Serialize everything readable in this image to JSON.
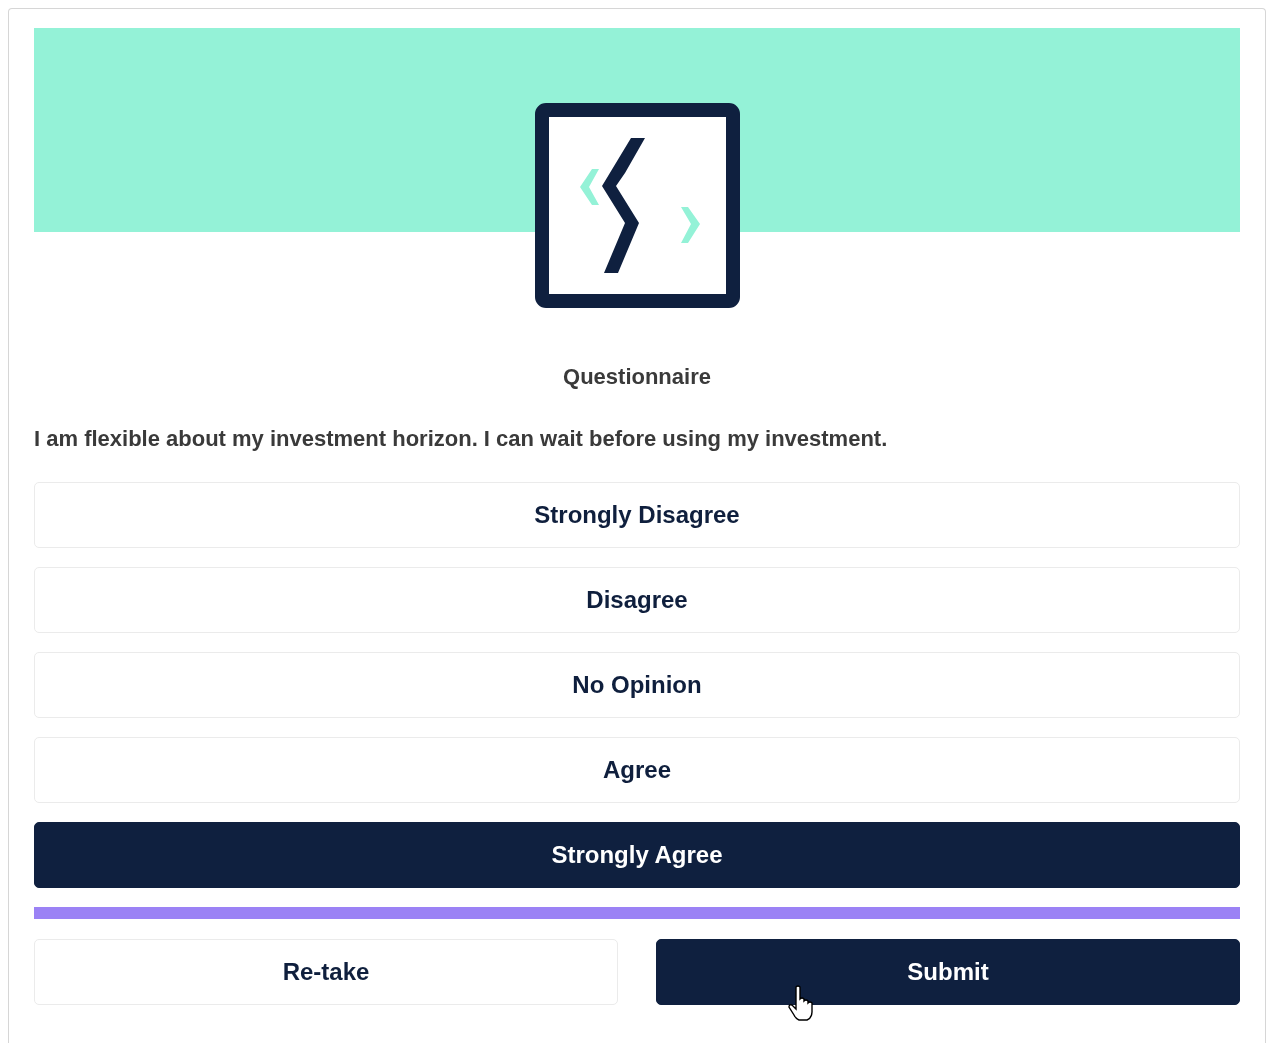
{
  "header": {
    "title": "Questionnaire"
  },
  "question": "I am flexible about my investment horizon. I can wait before using my investment.",
  "options": [
    {
      "label": "Strongly Disagree",
      "selected": false
    },
    {
      "label": "Disagree",
      "selected": false
    },
    {
      "label": "No Opinion",
      "selected": false
    },
    {
      "label": "Agree",
      "selected": false
    },
    {
      "label": "Strongly Agree",
      "selected": true
    }
  ],
  "progress": {
    "level": 1
  },
  "buttons": [
    {
      "label": "Re-take",
      "kind": "secondary"
    },
    {
      "label": "Submit",
      "kind": "primary"
    }
  ]
}
